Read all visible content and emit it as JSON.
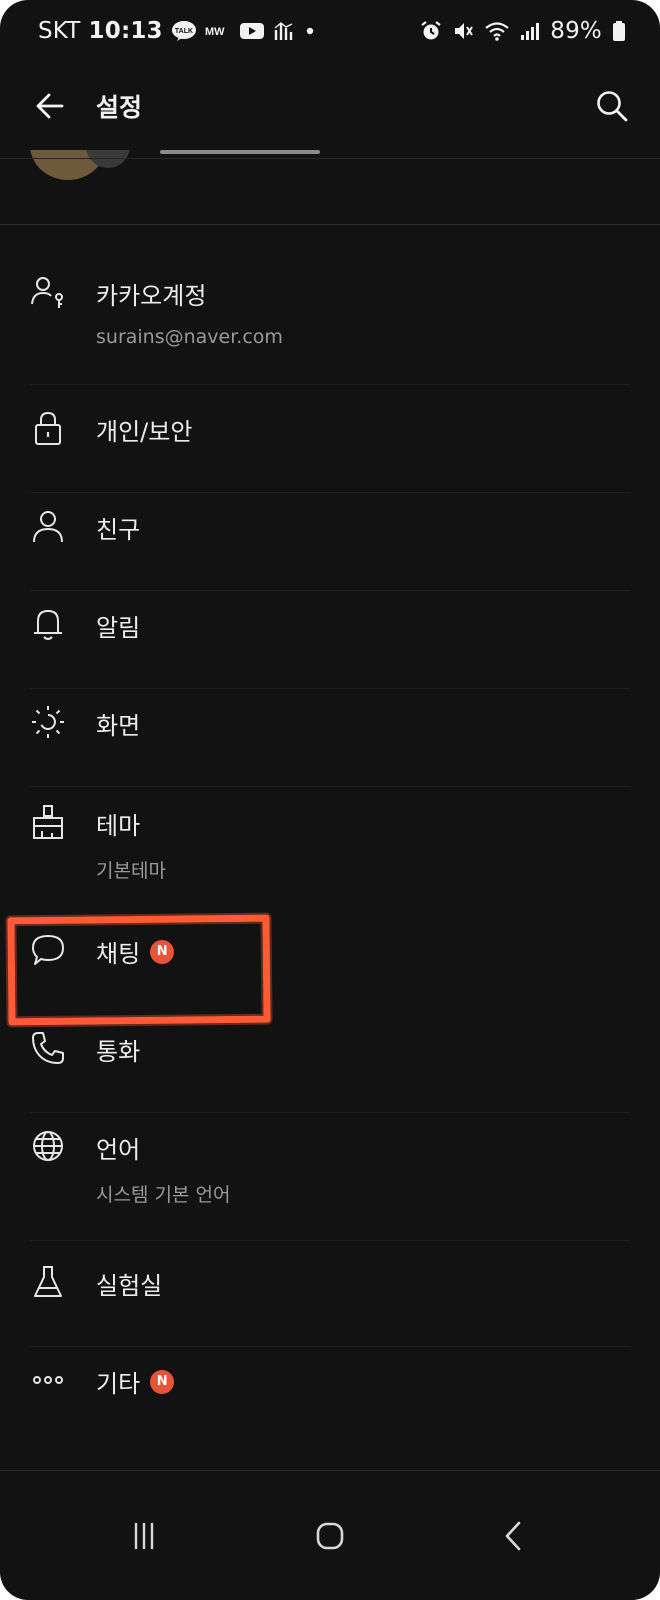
{
  "status_bar": {
    "carrier": "SKT",
    "time": "10:13",
    "battery": "89%",
    "left_icons": [
      "kakaotalk-icon",
      "mw-icon",
      "youtube-icon",
      "chart-app-icon",
      "dot-icon"
    ],
    "right_icons": [
      "alarm-icon",
      "mute-icon",
      "wifi-icon",
      "signal-icon",
      "battery-icon"
    ],
    "kakao_badge_text": "TALK",
    "mw_text": "MW"
  },
  "app_bar": {
    "title": "설정"
  },
  "menu": {
    "items": [
      {
        "label": "카카오계정",
        "sub": "surains@naver.com",
        "icon": "account-key-icon",
        "badge": ""
      },
      {
        "label": "개인/보안",
        "sub": "",
        "icon": "lock-icon",
        "badge": ""
      },
      {
        "label": "친구",
        "sub": "",
        "icon": "person-icon",
        "badge": ""
      },
      {
        "label": "알림",
        "sub": "",
        "icon": "bell-icon",
        "badge": ""
      },
      {
        "label": "화면",
        "sub": "",
        "icon": "brightness-icon",
        "badge": ""
      },
      {
        "label": "테마",
        "sub": "기본테마",
        "icon": "theme-brush-icon",
        "badge": ""
      },
      {
        "label": "채팅",
        "sub": "",
        "icon": "chat-bubble-icon",
        "badge": "N"
      },
      {
        "label": "통화",
        "sub": "",
        "icon": "phone-icon",
        "badge": ""
      },
      {
        "label": "언어",
        "sub": "시스템 기본 언어",
        "icon": "globe-icon",
        "badge": ""
      },
      {
        "label": "실험실",
        "sub": "",
        "icon": "flask-icon",
        "badge": ""
      },
      {
        "label": "기타",
        "sub": "",
        "icon": "more-dots-icon",
        "badge": "N"
      }
    ]
  },
  "colors": {
    "background": "#121212",
    "text": "#ececec",
    "subtext": "#9a9a9a",
    "badge": "#e8533a",
    "highlight": "#ff5a36"
  },
  "nav_bar": {
    "icons": [
      "recents-icon",
      "home-icon",
      "back-nav-icon"
    ]
  }
}
